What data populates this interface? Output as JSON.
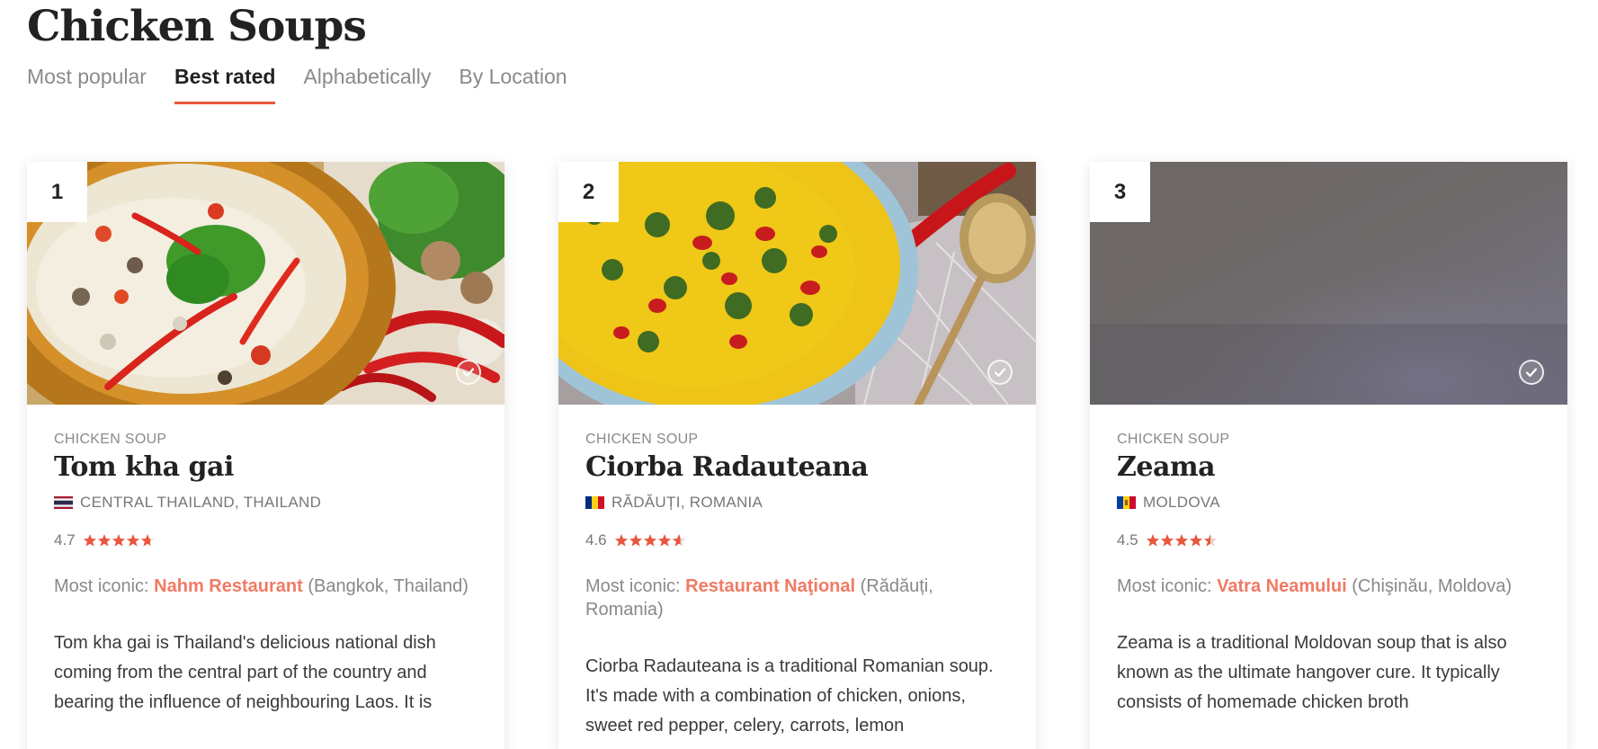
{
  "page": {
    "title": "Chicken Soups"
  },
  "tabs": [
    {
      "label": "Most popular",
      "active": false
    },
    {
      "label": "Best rated",
      "active": true
    },
    {
      "label": "Alphabetically",
      "active": false
    },
    {
      "label": "By Location",
      "active": false
    }
  ],
  "colors": {
    "accent": "#e8573e",
    "link": "#f07a64",
    "star": "#e8573e"
  },
  "cards": [
    {
      "rank": "1",
      "category": "CHICKEN SOUP",
      "name": "Tom kha gai",
      "flag": "thailand-flag-icon",
      "location": "CENTRAL THAILAND, THAILAND",
      "rating": "4.7",
      "stars": 4.7,
      "iconic_label": "Most iconic: ",
      "iconic_restaurant": "Nahm Restaurant",
      "iconic_place": " (Bangkok, Thailand)",
      "description": "Tom kha gai is Thailand's delicious national dish coming from the central part of the country and bearing the influence of neighbouring Laos. It is"
    },
    {
      "rank": "2",
      "category": "CHICKEN SOUP",
      "name": "Ciorba Radauteana",
      "flag": "romania-flag-icon",
      "location": "RĂDĂUȚI, ROMANIA",
      "rating": "4.6",
      "stars": 4.6,
      "iconic_label": "Most iconic: ",
      "iconic_restaurant": "Restaurant Naţional",
      "iconic_place": " (Rădăuți, Romania)",
      "description": "Ciorba Radauteana is a traditional Romanian soup. It's made with a combination of chicken, onions, sweet red pepper, celery, carrots, lemon"
    },
    {
      "rank": "3",
      "category": "CHICKEN SOUP",
      "name": "Zeama",
      "flag": "moldova-flag-icon",
      "location": "MOLDOVA",
      "rating": "4.5",
      "stars": 4.5,
      "iconic_label": "Most iconic: ",
      "iconic_restaurant": "Vatra Neamului",
      "iconic_place": " (Chişinău, Moldova)",
      "description": "Zeama is a traditional Moldovan soup that is also known as the ultimate hangover cure. It typically consists of homemade chicken broth"
    }
  ]
}
